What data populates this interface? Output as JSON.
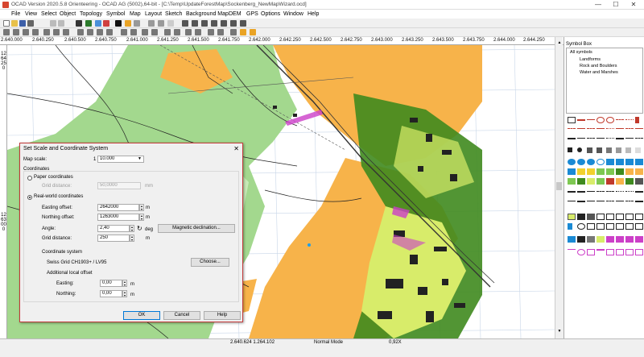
{
  "window": {
    "title": "OCAD Version 2020.5.8 Orienteering - OCAD AG (5002),64-bit - [C:\\Temp\\UpdateForestMap\\Sockenberg_NewMapWizard.ocd]",
    "minimize": "—",
    "maximize": "☐",
    "close": "✕"
  },
  "menu": [
    "File",
    "View",
    "Select",
    "Object",
    "Topology",
    "Symbol",
    "Map",
    "Layout",
    "Sketch",
    "Background Map",
    "DEM",
    "GPS",
    "Options",
    "Window",
    "Help"
  ],
  "ruler_top": [
    "2.640.000",
    "2.640.250",
    "2.640.500",
    "2.640.750",
    "2.641.000",
    "2.641.250",
    "2.641.500",
    "2.641.750",
    "2.642.000",
    "2.642.250",
    "2.642.500",
    "2.642.750",
    "2.643.000",
    "2.643.250",
    "2.643.500",
    "2.643.750",
    "2.644.000",
    "2.644.250"
  ],
  "ruler_left": [
    "1264250",
    "1263000"
  ],
  "symbol_box": {
    "header": "Symbol Box",
    "tree": [
      "All symbols",
      "Landforms",
      "Rock and Boulders",
      "Water and Marshes"
    ]
  },
  "dialog": {
    "title": "Set Scale and Coordinate System",
    "close": "✕",
    "map_scale_label": "Map scale:",
    "map_scale_prefix": "1 :",
    "map_scale_value": "10.000",
    "coordinates_label": "Coordinates",
    "paper_coordinates": "Paper coordinates",
    "grid_distance_paper_label": "Grid distance:",
    "grid_distance_paper_value": "50,0000",
    "grid_distance_paper_unit": "mm",
    "real_world_coordinates": "Real-world coordinates",
    "easting_label": "Easting offset:",
    "easting_value": "2642000",
    "easting_unit": "m",
    "northing_label": "Northing offset:",
    "northing_value": "1263000",
    "northing_unit": "m",
    "angle_label": "Angle:",
    "angle_value": "2,40",
    "angle_unit": "deg",
    "magnetic_declination_button": "Magnetic declination...",
    "grid_distance_label": "Grid distance:",
    "grid_distance_value": "250",
    "grid_distance_unit": "m",
    "coordinate_system_label": "Coordinate system",
    "coordinate_system_value": "Swiss Grid  CH1903+ / LV95",
    "choose_button": "Choose...",
    "additional_offset_label": "Additional local offset",
    "easting2_label": "Easting:",
    "easting2_value": "0,00",
    "easting2_unit": "m",
    "northing2_label": "Northing:",
    "northing2_value": "0,00",
    "northing2_unit": "m",
    "ok_button": "OK",
    "cancel_button": "Cancel",
    "help_button": "Help"
  },
  "status": {
    "coords": "2.640.624  1.264.102",
    "mode": "Normal Mode",
    "zoom": "0,92X"
  },
  "colors": {
    "open_land": "#f7b34a",
    "forest_green": "#a3d88e",
    "dark_green": "#3f8a1e",
    "lime": "#d8ec6a",
    "building": "#222222",
    "dialog_border": "#c43a3a"
  }
}
